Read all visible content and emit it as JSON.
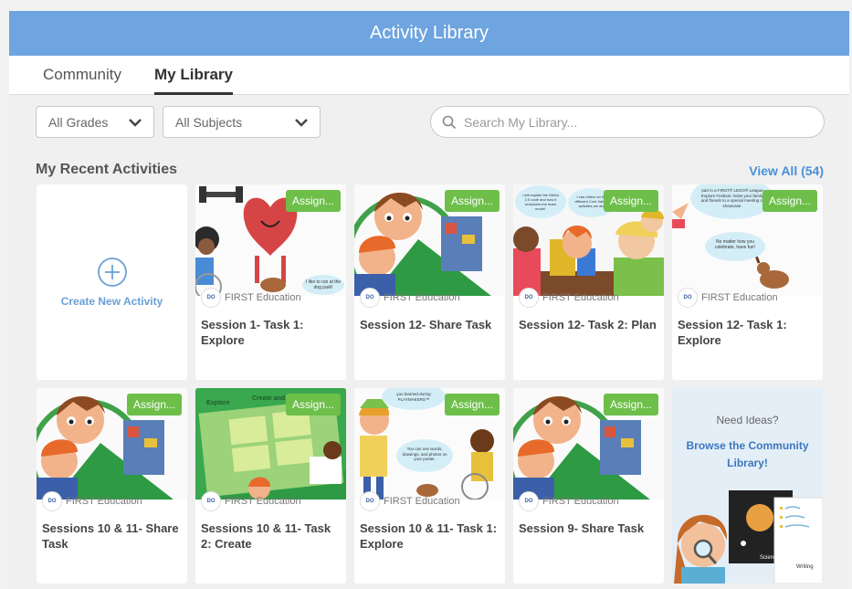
{
  "window": {
    "title": "Activity Library"
  },
  "tabs": [
    {
      "label": "Community"
    },
    {
      "label": "My Library"
    }
  ],
  "filters": {
    "grades": "All Grades",
    "subjects": "All Subjects",
    "search_placeholder": "Search My Library..."
  },
  "recent": {
    "title": "My Recent Activities",
    "view_all": "View All (54)",
    "create_label": "Create New Activity",
    "assign_label": "Assign...",
    "cards": [
      {
        "title": "Session 1- Task 1: Explore",
        "publisher": "FIRST Education",
        "bubble": "I like to run at the dog park!"
      },
      {
        "title": "Session 12- Share Task",
        "publisher": "FIRST Education"
      },
      {
        "title": "Session 12- Task 2: Plan",
        "publisher": "FIRST Education",
        "bubble": "I will explain the WeDo 2.0 code and how it motorizes the team model.",
        "bubble2": "I can reflect on the different Core Values activities we did."
      },
      {
        "title": "Session 12- Task 1: Explore",
        "publisher": "FIRST Education",
        "bubble": "No matter how you celebrate, have fun!",
        "bubble2": "part in a FIRST® LEGO® League Explore Festival. Invite your family and friends to a special meeting or showcase."
      },
      {
        "title": "Sessions 10 & 11- Share Task",
        "publisher": "FIRST Education"
      },
      {
        "title": "Sessions 10 & 11- Task 2: Create",
        "publisher": "FIRST Education",
        "poster": "Explore",
        "poster2": "Create and Sh"
      },
      {
        "title": "Session 10 & 11- Task 1: Explore",
        "publisher": "FIRST Education",
        "bubble": "you learned during PLAYMAKERS™",
        "bubble2": "You can use words, drawings, and photos on your poster."
      },
      {
        "title": "Session 9- Share Task",
        "publisher": "FIRST Education"
      }
    ]
  },
  "ideas": {
    "question": "Need Ideas?",
    "link": "Browse the Community Library!",
    "label_science": "Science",
    "label_writing": "Writing"
  },
  "colors": {
    "header": "#6ea4df",
    "assign": "#6dbf4a",
    "link": "#4a90d9"
  }
}
